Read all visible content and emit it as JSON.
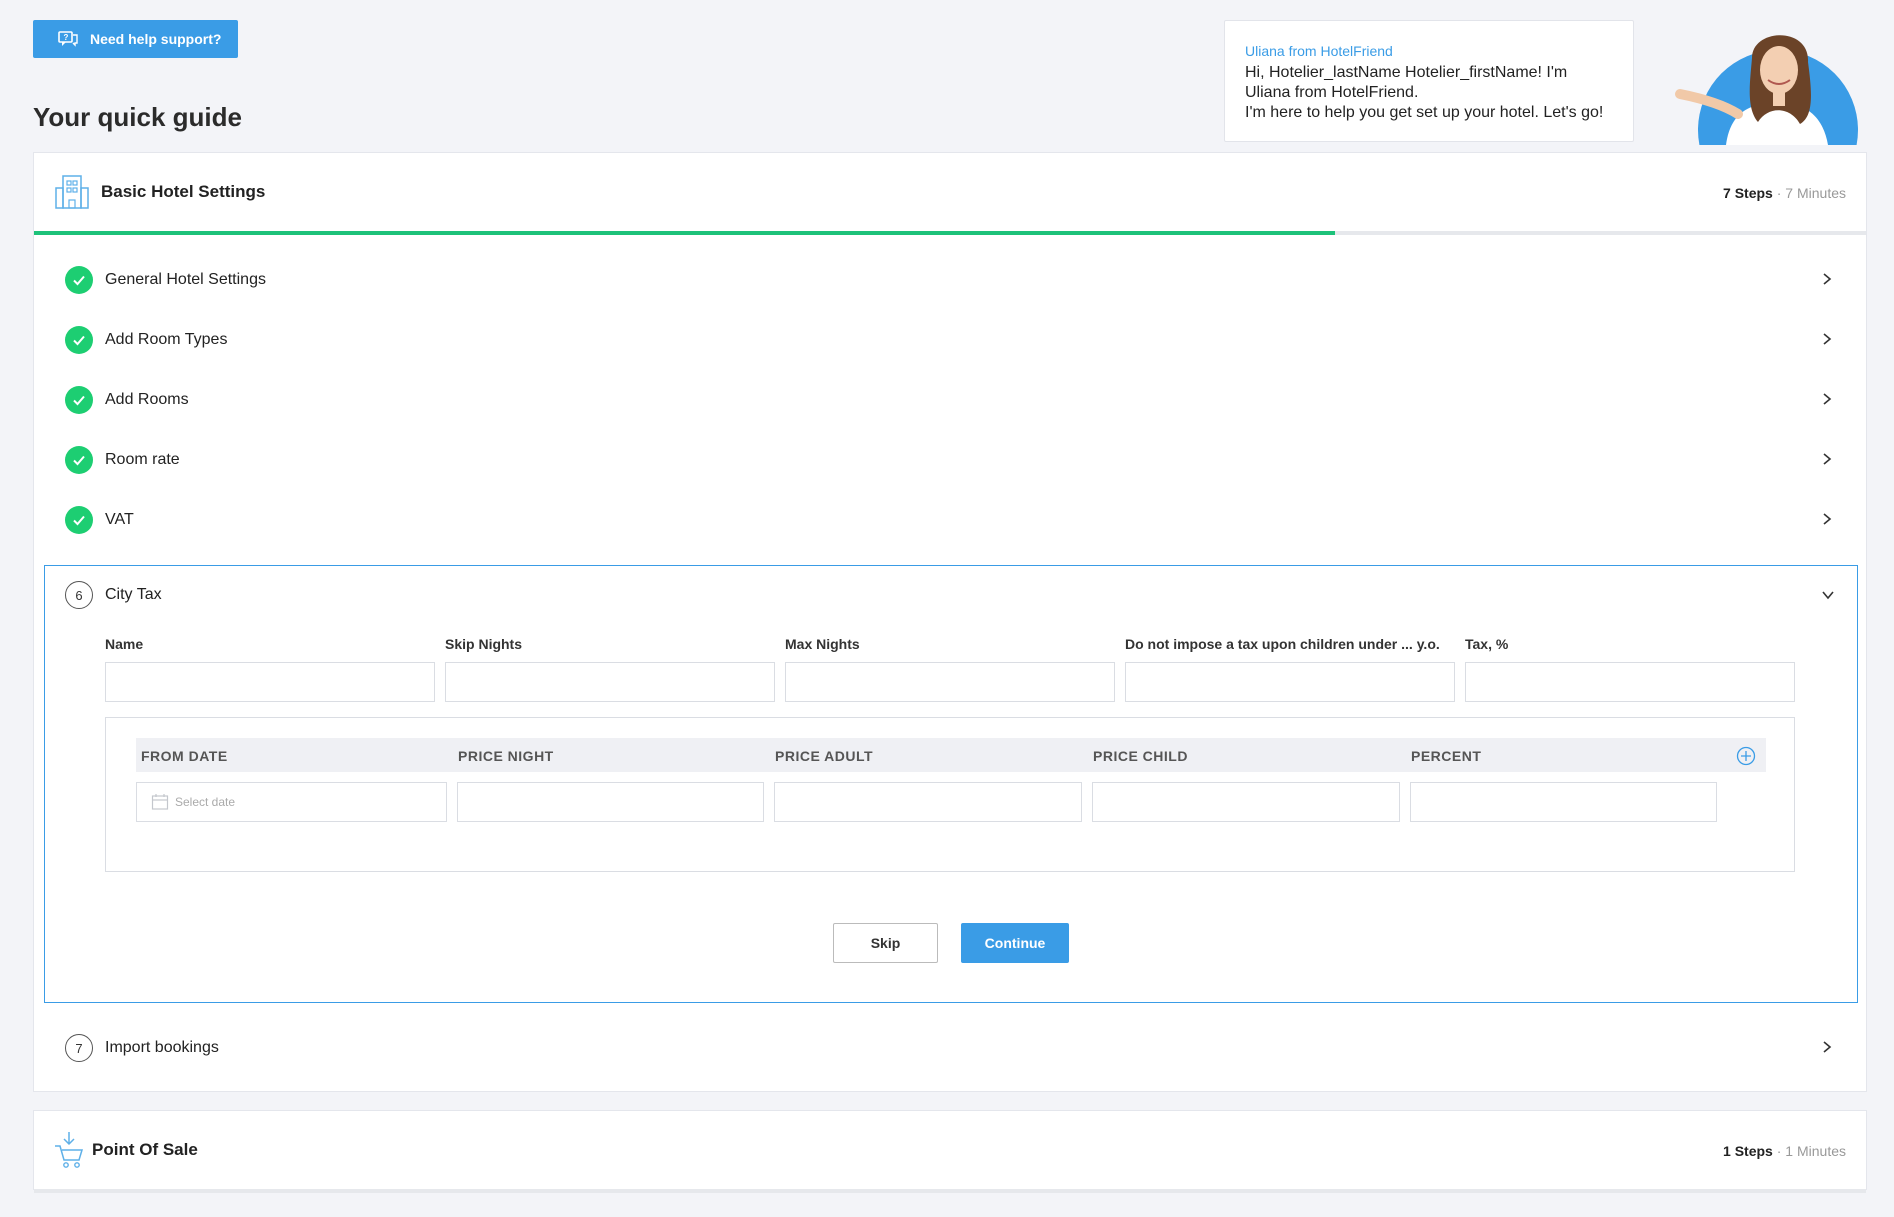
{
  "help_button": {
    "label": "Need help support?"
  },
  "page_title": "Your quick guide",
  "assistant": {
    "from": "Uliana from HotelFriend",
    "message_line1": "Hi, Hotelier_lastName Hotelier_firstName! I'm",
    "message_line2": "Uliana from HotelFriend.",
    "message_line3": "I'm here to help you get set up your hotel. Let's go!"
  },
  "guide": {
    "title": "Basic Hotel Settings",
    "steps_count": "7 Steps",
    "duration": " · 7 Minutes",
    "progress": 0.71,
    "completed_steps": [
      {
        "label": "General Hotel Settings"
      },
      {
        "label": "Add Room Types"
      },
      {
        "label": "Add Rooms"
      },
      {
        "label": "Room rate"
      },
      {
        "label": "VAT"
      }
    ],
    "current_step": {
      "number": "6",
      "label": "City Tax",
      "fields": [
        {
          "label": "Name",
          "value": ""
        },
        {
          "label": "Skip Nights",
          "value": ""
        },
        {
          "label": "Max Nights",
          "value": ""
        },
        {
          "label": "Do not impose a tax upon children under ... y.o.",
          "value": ""
        },
        {
          "label": "Tax, %",
          "value": ""
        }
      ],
      "table_headers": [
        "FROM DATE",
        "PRICE NIGHT",
        "PRICE ADULT",
        "PRICE CHILD",
        "PERCENT"
      ],
      "date_placeholder": "Select date",
      "skip_label": "Skip",
      "continue_label": "Continue"
    },
    "next_step": {
      "number": "7",
      "label": "Import bookings"
    }
  },
  "pos": {
    "title": "Point Of Sale",
    "steps_count": "1 Steps",
    "duration": " · 1 Minutes"
  },
  "colors": {
    "accent": "#3a9ce6",
    "success": "#1dce72",
    "progress": "#1dc27a"
  }
}
